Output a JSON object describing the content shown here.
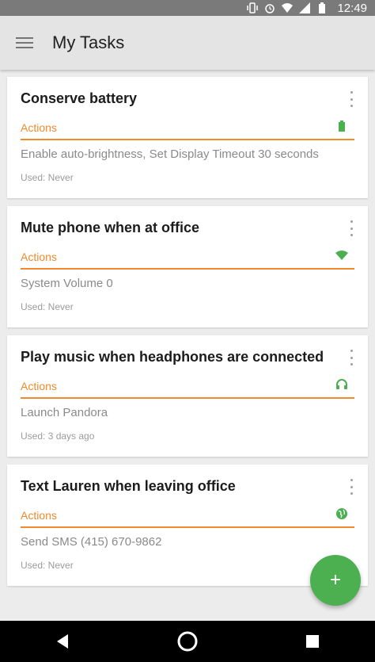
{
  "status_bar": {
    "time": "12:49",
    "icons": [
      "vibrate-icon",
      "alarm-icon",
      "wifi-icon",
      "signal-icon",
      "battery-icon"
    ]
  },
  "app_bar": {
    "menu_icon": "hamburger-menu-icon",
    "title": "My Tasks"
  },
  "tasks": [
    {
      "title": "Conserve battery",
      "actions_label": "Actions",
      "trigger_icon": "battery-icon",
      "action_detail": "Enable auto-brightness, Set Display Timeout 30 seconds",
      "used": "Used: Never"
    },
    {
      "title": "Mute phone when at office",
      "actions_label": "Actions",
      "trigger_icon": "wifi-icon",
      "action_detail": "System Volume 0",
      "used": "Used: Never"
    },
    {
      "title": "Play music when headphones are connected",
      "actions_label": "Actions",
      "trigger_icon": "headphones-icon",
      "action_detail": "Launch Pandora",
      "used": "Used: 3 days ago"
    },
    {
      "title": "Text Lauren when leaving office",
      "actions_label": "Actions",
      "trigger_icon": "location-globe-icon",
      "action_detail": "Send SMS (415) 670-9862",
      "used": "Used: Never"
    }
  ],
  "fab": {
    "label": "+"
  },
  "colors": {
    "accent_orange": "#f08a2c",
    "trigger_green": "#4caf50",
    "fab_green": "#4caf50"
  },
  "nav_bar": {
    "buttons": [
      "back-icon",
      "home-icon",
      "recents-icon"
    ]
  }
}
